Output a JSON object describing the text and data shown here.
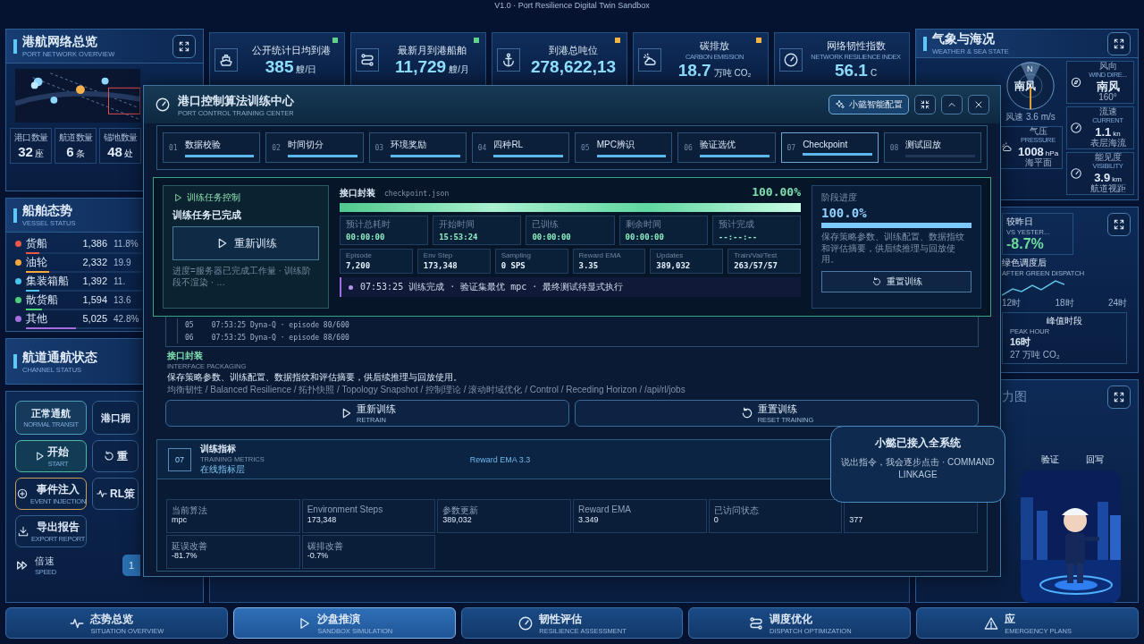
{
  "header": {
    "version": "V1.0 · Port Resilience Digital Twin Sandbox"
  },
  "network": {
    "title": "港航网络总览",
    "subtitle": "PORT NETWORK OVERVIEW",
    "stats": [
      {
        "label": "港口数量",
        "value": "32",
        "unit": "座"
      },
      {
        "label": "航道数量",
        "value": "6",
        "unit": "条"
      },
      {
        "label": "锚地数量",
        "value": "48",
        "unit": "处"
      }
    ]
  },
  "kpis": [
    {
      "title": "公开统计日均到港",
      "value": "385",
      "unit": "艘/日",
      "color": "#5fd38a"
    },
    {
      "title": "最新月到港船舶",
      "value": "11,729",
      "unit": "艘/月",
      "color": "#5fd38a"
    },
    {
      "title": "到港总吨位",
      "value": "278,622,13",
      "color": "#f2b544"
    },
    {
      "title": "碳排放",
      "subtitle": "CARBON EMISSION",
      "value": "18.7",
      "unit": "万吨 CO₂",
      "color": "#f2b544"
    },
    {
      "title": "网络韧性指数",
      "subtitle": "NETWORK RESILIENCE INDEX",
      "value": "56.1",
      "unit": "C"
    }
  ],
  "weather": {
    "title": "气象与海况",
    "subtitle": "WEATHER & SEA STATE",
    "compass": {
      "north": "N",
      "direction": "南风",
      "speed": "风速 3.6 m/s"
    },
    "pressure": {
      "label": "气压",
      "sub": "PRESSURE",
      "value": "1008",
      "unit": "hPa",
      "note": "海平面"
    },
    "tiles": [
      {
        "label": "风向",
        "sub": "WIND DIRE...",
        "value": "南风",
        "note": "160°"
      },
      {
        "label": "流速",
        "sub": "CURRENT",
        "value": "1.1",
        "unit": "kn",
        "note": "表层海流"
      },
      {
        "label": "能见度",
        "sub": "VISIBILITY",
        "value": "3.9",
        "unit": "km",
        "note": "航道视距"
      }
    ]
  },
  "vessels_panel": {
    "title": "船舶态势",
    "subtitle": "VESSEL STATUS",
    "vessels": [
      {
        "name": "货船",
        "count": "1,386",
        "share": "11.8%",
        "color": "#e8574a",
        "level": 0.118
      },
      {
        "name": "油轮",
        "count": "2,332",
        "share": "19.9",
        "color": "#f5a83a",
        "level": 0.199
      },
      {
        "name": "集装箱船",
        "count": "1,392",
        "share": "11.",
        "color": "#4cc3f0",
        "level": 0.118
      },
      {
        "name": "散货船",
        "count": "1,594",
        "share": "13.6",
        "color": "#49d07a",
        "level": 0.136
      },
      {
        "name": "其他",
        "count": "5,025",
        "share": "42.8%",
        "color": "#a66de0",
        "level": 0.428
      }
    ]
  },
  "channel": {
    "title": "航道通航状态",
    "subtitle": "CHANNEL STATUS"
  },
  "controls": {
    "scenarios": [
      {
        "label": "正常通航",
        "sub": "NORMAL TRANSIT",
        "selected": true
      },
      {
        "label": "港口拥",
        "selected": false
      }
    ],
    "actions": [
      {
        "label": "开始",
        "sub": "START",
        "kind": "primary"
      },
      {
        "label": "重",
        "kind": "normal"
      },
      {
        "label": "事件注入",
        "sub": "EVENT INJECTION",
        "kind": "warning"
      },
      {
        "label": "RL策",
        "kind": "normal"
      },
      {
        "label": "导出报告",
        "sub": "EXPORT REPORT",
        "kind": "normal"
      }
    ],
    "speed": {
      "label": "倍速",
      "sub": "SPEED",
      "value": "1"
    }
  },
  "emission": {
    "compare": {
      "label": "较昨日",
      "sub": "VS YESTER...",
      "value": "-8.7%"
    },
    "after": {
      "label": "绿色调度后",
      "sub": "AFTER GREEN DISPATCH"
    },
    "ticks": [
      "12时",
      "18时",
      "24时"
    ],
    "peak": {
      "title": "峰值时段",
      "label": "PEAK HOUR",
      "value": "16时",
      "note": "27 万吨 CO₂"
    }
  },
  "lower_panel": {
    "title": "力图",
    "labels": [
      "验证",
      "回写"
    ]
  },
  "modal": {
    "title": "港口控制算法训练中心",
    "subtitle": "PORT CONTROL TRAINING CENTER",
    "assist_button": "小懿智能配置",
    "steps": [
      {
        "index": "01",
        "label": "数据校验",
        "level": 1,
        "selected": false
      },
      {
        "index": "02",
        "label": "时间切分",
        "level": 1,
        "selected": false
      },
      {
        "index": "03",
        "label": "环境奖励",
        "level": 1,
        "selected": false
      },
      {
        "index": "04",
        "label": "四种RL",
        "level": 1,
        "selected": false
      },
      {
        "index": "05",
        "label": "MPC辨识",
        "level": 1,
        "selected": false
      },
      {
        "index": "06",
        "label": "验证选优",
        "level": 1,
        "selected": false
      },
      {
        "index": "07",
        "label": "Checkpoint",
        "level": 1,
        "selected": true
      },
      {
        "index": "08",
        "label": "测试回放",
        "level": 0,
        "selected": false
      }
    ],
    "control": {
      "heading": "训练任务控制",
      "status": "训练任务已完成",
      "button": "重新训练",
      "note": "进度=服务器已完成工作量 · 训练阶段不渲染 · …"
    },
    "job": {
      "stage": "接口封装",
      "file": "checkpoint.json",
      "percent": "100.00%",
      "level": 1,
      "times": [
        {
          "label": "预计总耗时",
          "value": "00:00:00"
        },
        {
          "label": "开始时间",
          "value": "15:53:24"
        },
        {
          "label": "已训练",
          "value": "00:00:00"
        },
        {
          "label": "剩余时间",
          "value": "00:00:00"
        },
        {
          "label": "预计完成",
          "value": "--:--:--"
        }
      ],
      "metrics": [
        {
          "label": "Episode",
          "value": "7,200"
        },
        {
          "label": "Env Step",
          "value": "173,348"
        },
        {
          "label": "Sampling",
          "value": "0 SPS"
        },
        {
          "label": "Reward EMA",
          "value": "3.35"
        },
        {
          "label": "Updates",
          "value": "389,032"
        },
        {
          "label": "Train/Val/Test",
          "value": "263/57/57"
        }
      ],
      "log": "07:53:25 训练完成 · 验证集最优 mpc · 最终测试待显式执行"
    },
    "phase": {
      "label": "阶段进度",
      "value": "100.0%",
      "level": 1,
      "note": "保存策略参数、训练配置、数据指纹和评估摘要，供后续推理与回放使用。",
      "button": "重置训练"
    },
    "logs": [
      {
        "index": "05",
        "text": "07:53:25 Dyna-Q · episode 80/600"
      },
      {
        "index": "06",
        "text": "07:53:25 Dyna-Q · episode 88/600"
      }
    ],
    "packaging": {
      "title": "接口封装",
      "subtitle": "INTERFACE PACKAGING",
      "description": "保存策略参数、训练配置、数据指纹和评估摘要，供后续推理与回放使用。",
      "tags": "均衡韧性 / Balanced Resilience / 拓扑快照 / Topology Snapshot / 控制理论 / 滚动时域优化 / Control / Receding Horizon / /api/rl/jobs"
    },
    "actions": [
      {
        "label": "重新训练",
        "sub": "RETRAIN"
      },
      {
        "label": "重置训练",
        "sub": "RESET TRAINING"
      }
    ],
    "metrics_section": {
      "index": "07",
      "title": "训练指标",
      "subtitle": "TRAINING METRICS",
      "layer": "在线指标层",
      "summary": "Reward EMA 3.3",
      "cells": [
        {
          "label": "当前算法",
          "value": "mpc"
        },
        {
          "label": "Environment Steps",
          "value": "173,348"
        },
        {
          "label": "参数更新",
          "value": "389,032"
        },
        {
          "label": "Reward EMA",
          "value": "3.349"
        },
        {
          "label": "已访问状态",
          "value": "0"
        },
        {
          "value": "377"
        },
        {
          "label": "延误改善",
          "value": "-81.7%"
        },
        {
          "label": "碳排改善",
          "value": "-0.7%"
        }
      ]
    }
  },
  "assistant": {
    "title": "小懿已接入全系统",
    "message": "说出指令，我会逐步点击 · COMMAND LINKAGE"
  },
  "nav": [
    {
      "label": "态势总览",
      "sub": "SITUATION OVERVIEW",
      "selected": false
    },
    {
      "label": "沙盘推演",
      "sub": "SANDBOX SIMULATION",
      "selected": true
    },
    {
      "label": "韧性评估",
      "sub": "RESILIENCE ASSESSMENT",
      "selected": false
    },
    {
      "label": "调度优化",
      "sub": "DISPATCH OPTIMIZATION",
      "selected": false
    },
    {
      "label": "应",
      "sub": "EMERGENCY PLANS",
      "selected": false
    }
  ]
}
